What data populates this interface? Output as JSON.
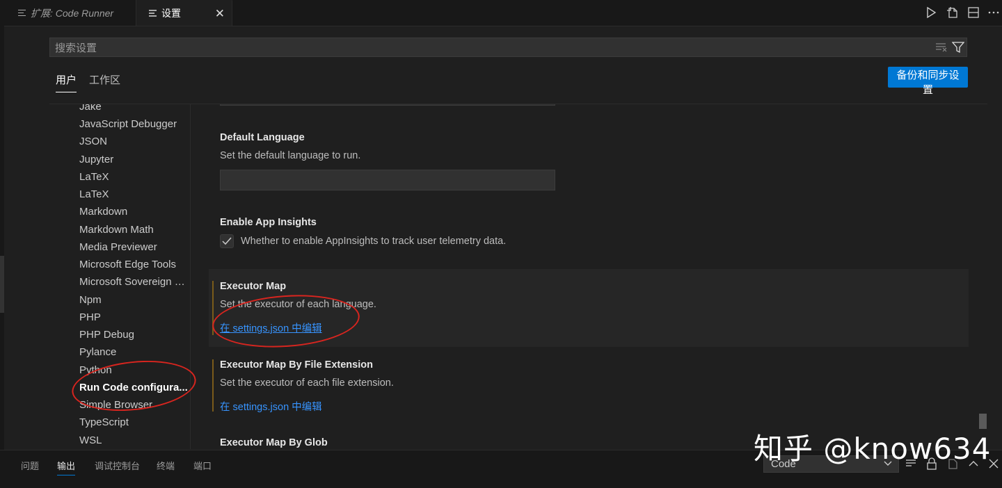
{
  "tabs": [
    {
      "label": "扩展: Code Runner"
    },
    {
      "label": "设置",
      "close": "✕"
    }
  ],
  "search": {
    "placeholder": "搜索设置"
  },
  "scopes": {
    "user": "用户",
    "workspace": "工作区"
  },
  "sync_button": "备份和同步设置",
  "toc": {
    "items": [
      "Jake",
      "JavaScript Debugger",
      "JSON",
      "Jupyter",
      "LaTeX",
      "LaTeX",
      "Markdown",
      "Markdown Math",
      "Media Previewer",
      "Microsoft Edge Tools",
      "Microsoft Sovereign C...",
      "Npm",
      "PHP",
      "PHP Debug",
      "Pylance",
      "Python",
      "Run Code configura...",
      "Simple Browser",
      "TypeScript",
      "WSL"
    ],
    "active_index": 16
  },
  "settings": {
    "default_language": {
      "title": "Default Language",
      "desc": "Set the default language to run."
    },
    "app_insights": {
      "title": "Enable App Insights",
      "desc": "Whether to enable AppInsights to track user telemetry data.",
      "checked": true
    },
    "executor_map": {
      "title": "Executor Map",
      "desc": "Set the executor of each language.",
      "link": "在 settings.json 中编辑"
    },
    "executor_map_ext": {
      "title": "Executor Map By File Extension",
      "desc": "Set the executor of each file extension.",
      "link": "在 settings.json 中编辑"
    },
    "executor_map_glob": {
      "title": "Executor Map By Glob"
    }
  },
  "panel": {
    "tabs": [
      "问题",
      "输出",
      "调试控制台",
      "终端",
      "端口"
    ],
    "active_tab": 1,
    "output_channel": "Code"
  },
  "watermark": "知乎 @know634",
  "colors": {
    "accent": "#0078d4",
    "link": "#3794ff",
    "annotation": "#d8251f"
  }
}
